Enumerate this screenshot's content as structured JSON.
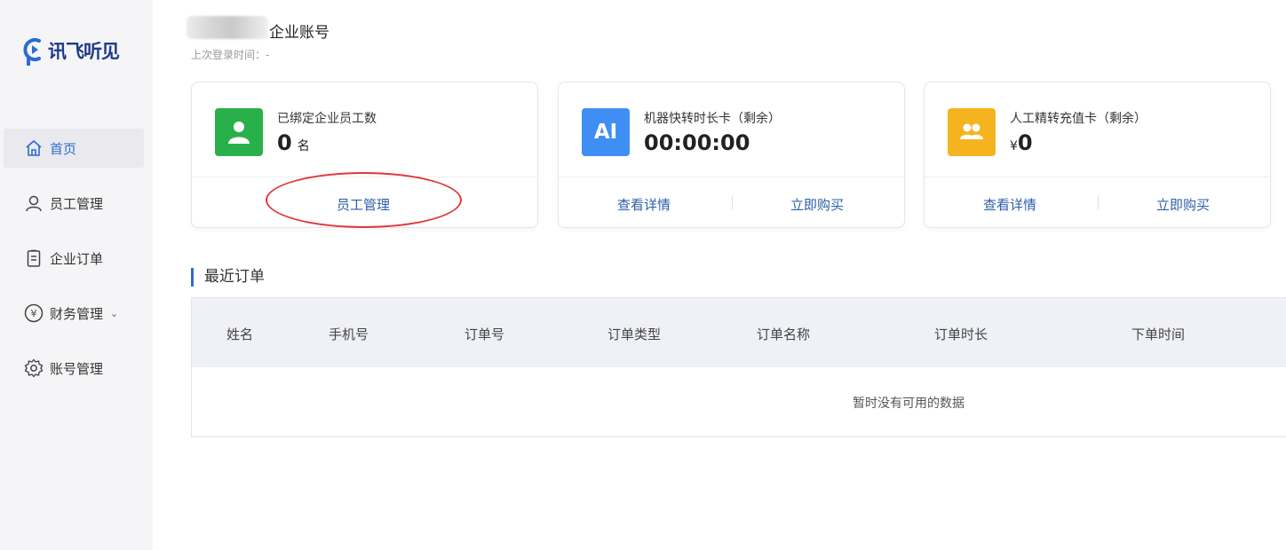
{
  "brand": {
    "name": "讯飞听见",
    "color": "#2c6bd2"
  },
  "sidebar": {
    "items": [
      {
        "label": "首页",
        "icon": "home-icon",
        "active": true
      },
      {
        "label": "员工管理",
        "icon": "user-icon"
      },
      {
        "label": "企业订单",
        "icon": "document-icon"
      },
      {
        "label": "财务管理",
        "icon": "yen-icon",
        "caret": "⌄"
      },
      {
        "label": "账号管理",
        "icon": "gear-icon"
      }
    ]
  },
  "header": {
    "account_title": "企业账号",
    "last_login": "上次登录时间：-"
  },
  "cards": [
    {
      "label": "已绑定企业员工数",
      "value": "0",
      "unit": "名",
      "icon": "person-icon",
      "color": "#2ab04a",
      "links": [
        "员工管理"
      ]
    },
    {
      "label": "机器快转时长卡（剩余）",
      "value": "00:00:00",
      "icon": "ai-icon",
      "icon_text": "AI",
      "color": "#3e8ef3",
      "links": [
        "查看详情",
        "立即购买"
      ]
    },
    {
      "label": "人工精转充值卡（剩余）",
      "value": "0",
      "currency": "¥",
      "icon": "group-icon",
      "color": "#f5b41f",
      "links": [
        "查看详情",
        "立即购买"
      ]
    }
  ],
  "recent_orders": {
    "title": "最近订单",
    "columns": [
      "姓名",
      "手机号",
      "订单号",
      "订单类型",
      "订单名称",
      "订单时长",
      "下单时间"
    ],
    "empty_text": "暂时没有可用的数据"
  },
  "annotation_color": "#e0393e"
}
